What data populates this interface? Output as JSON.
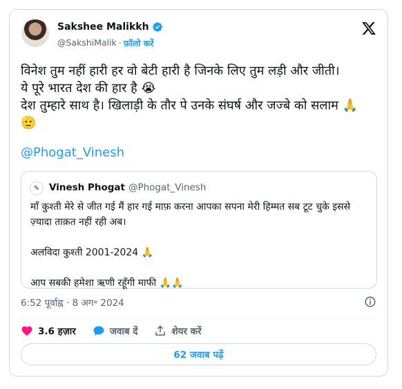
{
  "author": {
    "name": "Sakshee Malikkh",
    "handle": "@SakshiMalik",
    "separator": "·",
    "follow_label": "फ़ॉलो करें"
  },
  "tweet": {
    "text": "विनेश तुम नहीं हारी हर वो बेटी हारी है जिनके लिए तुम लड़ी और जीती।\nये पूरे भारत देश की हार है 😭\nदेश तुम्हारे साथ है। खिलाड़ी के तौर पे उनके संघर्ष और जज्बे को सलाम 🙏🫡",
    "mention": "@Phogat_Vinesh"
  },
  "quoted_tweet": {
    "name": "Vinesh Phogat",
    "handle": "@Phogat_Vinesh",
    "text": "माँ कुश्ती मेरे से जीत गई मैं हार गई माफ़ करना आपका सपना मेरी हिम्मत सब टूट चुके इससे ज़्यादा ताक़त नहीं रही अब।\n\nअलविदा कुश्ती 2001-2024 🙏\n\nआप सबकी हमेशा ऋणी रहूँगी माफी 🙏🙏"
  },
  "meta": {
    "time": "6:52 पूर्वाह्न",
    "separator": "·",
    "date": "8 अग॰ 2024"
  },
  "actions": {
    "likes": "3.6 हज़ार",
    "reply_label": "जवाब दें",
    "share_label": "शेयर करें"
  },
  "replies_button": "62 जवाब पढ़ें",
  "colors": {
    "accent": "#1d9bf0",
    "like": "#f91880",
    "text": "#0f1419",
    "muted": "#536471"
  }
}
